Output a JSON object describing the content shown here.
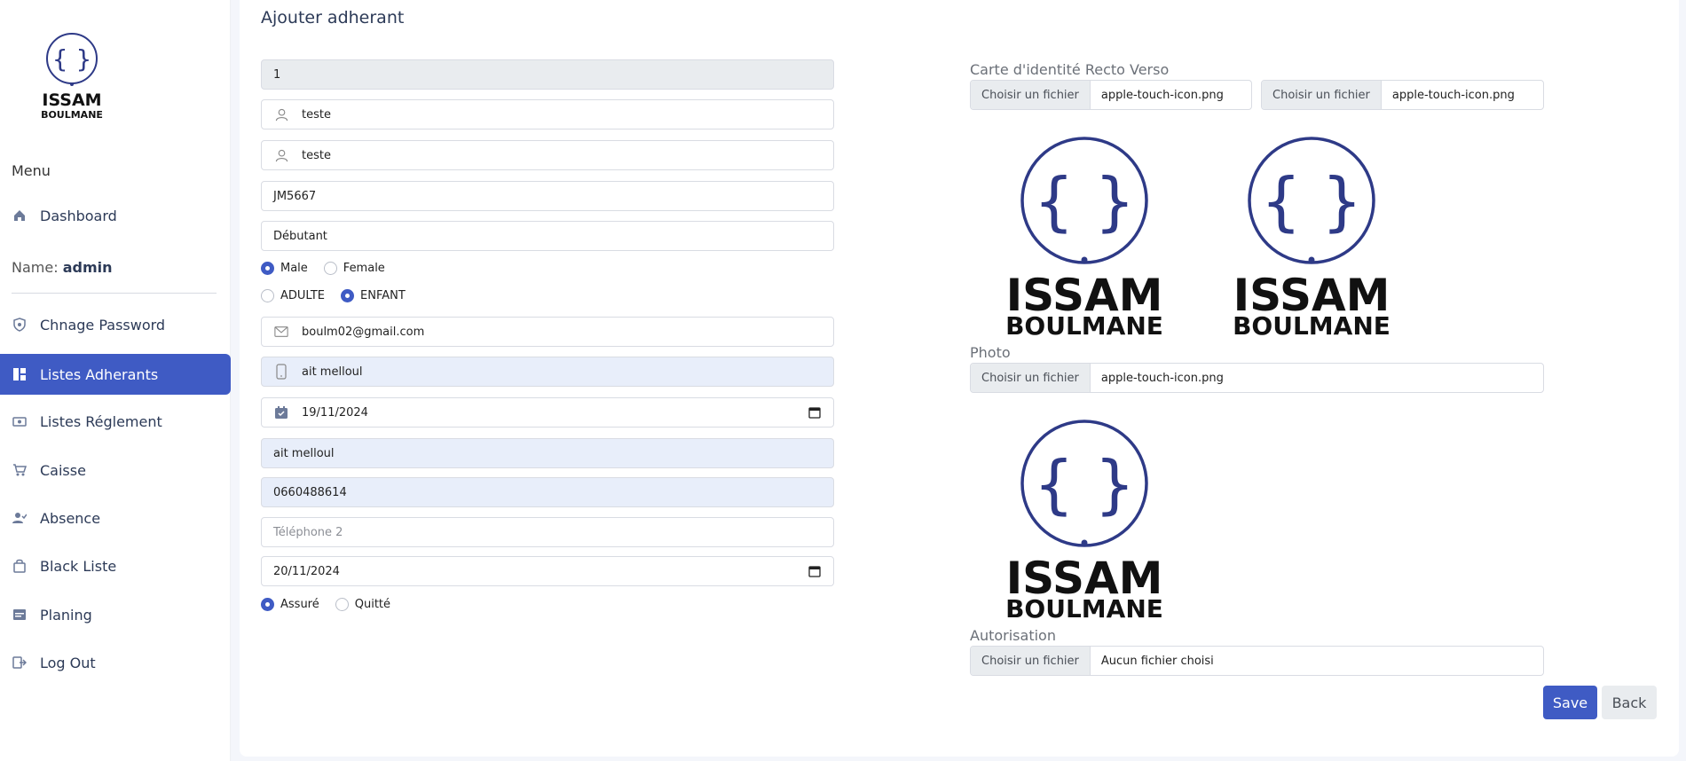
{
  "sidebar": {
    "logo_text": [
      "ISSAM",
      "BOULMANE"
    ],
    "menu_heading": "Menu",
    "dashboard": "Dashboard",
    "name_label": "Name:",
    "name_value": "admin",
    "items": [
      {
        "label": "Chnage Password",
        "icon": "shield-icon"
      },
      {
        "label": "Listes Adherants",
        "icon": "grid-icon",
        "active": true
      },
      {
        "label": "Listes Réglement",
        "icon": "money-icon"
      },
      {
        "label": "Caisse",
        "icon": "cart-icon"
      },
      {
        "label": "Absence",
        "icon": "user-check-icon"
      },
      {
        "label": "Black Liste",
        "icon": "bag-icon"
      },
      {
        "label": "Planing",
        "icon": "calendar-list-icon"
      },
      {
        "label": "Log Out",
        "icon": "logout-icon"
      }
    ]
  },
  "form": {
    "title": "Ajouter adherant",
    "id_value": "1",
    "nom_value": "teste",
    "prenom_value": "teste",
    "cin_value": "JM5667",
    "niveau_value": "Débutant",
    "gender": {
      "male": "Male",
      "female": "Female",
      "selected": "Male"
    },
    "category": {
      "adulte": "ADULTE",
      "enfant": "ENFANT",
      "selected": "ENFANT"
    },
    "email_value": "boulm02@gmail.com",
    "adresse_value": "ait melloul",
    "date_naissance_value": "19/11/2024",
    "ville_value": "ait melloul",
    "telephone_value": "0660488614",
    "telephone2_placeholder": "Téléphone 2",
    "date_inscription_value": "20/11/2024",
    "assurance": {
      "assure": "Assuré",
      "quitte": "Quitté",
      "selected": "Assuré"
    }
  },
  "uploads": {
    "carte_label": "Carte d'identité Recto Verso",
    "button_label": "Choisir un fichier",
    "recto_file": "apple-touch-icon.png",
    "verso_file": "apple-touch-icon.png",
    "photo_label": "Photo",
    "photo_file": "apple-touch-icon.png",
    "autorisation_label": "Autorisation",
    "autorisation_file": "Aucun fichier choisi"
  },
  "actions": {
    "save": "Save",
    "back": "Back"
  },
  "colors": {
    "primary": "#3f5bc4",
    "logo_navy": "#2e3a87",
    "logo_black": "#111111"
  }
}
